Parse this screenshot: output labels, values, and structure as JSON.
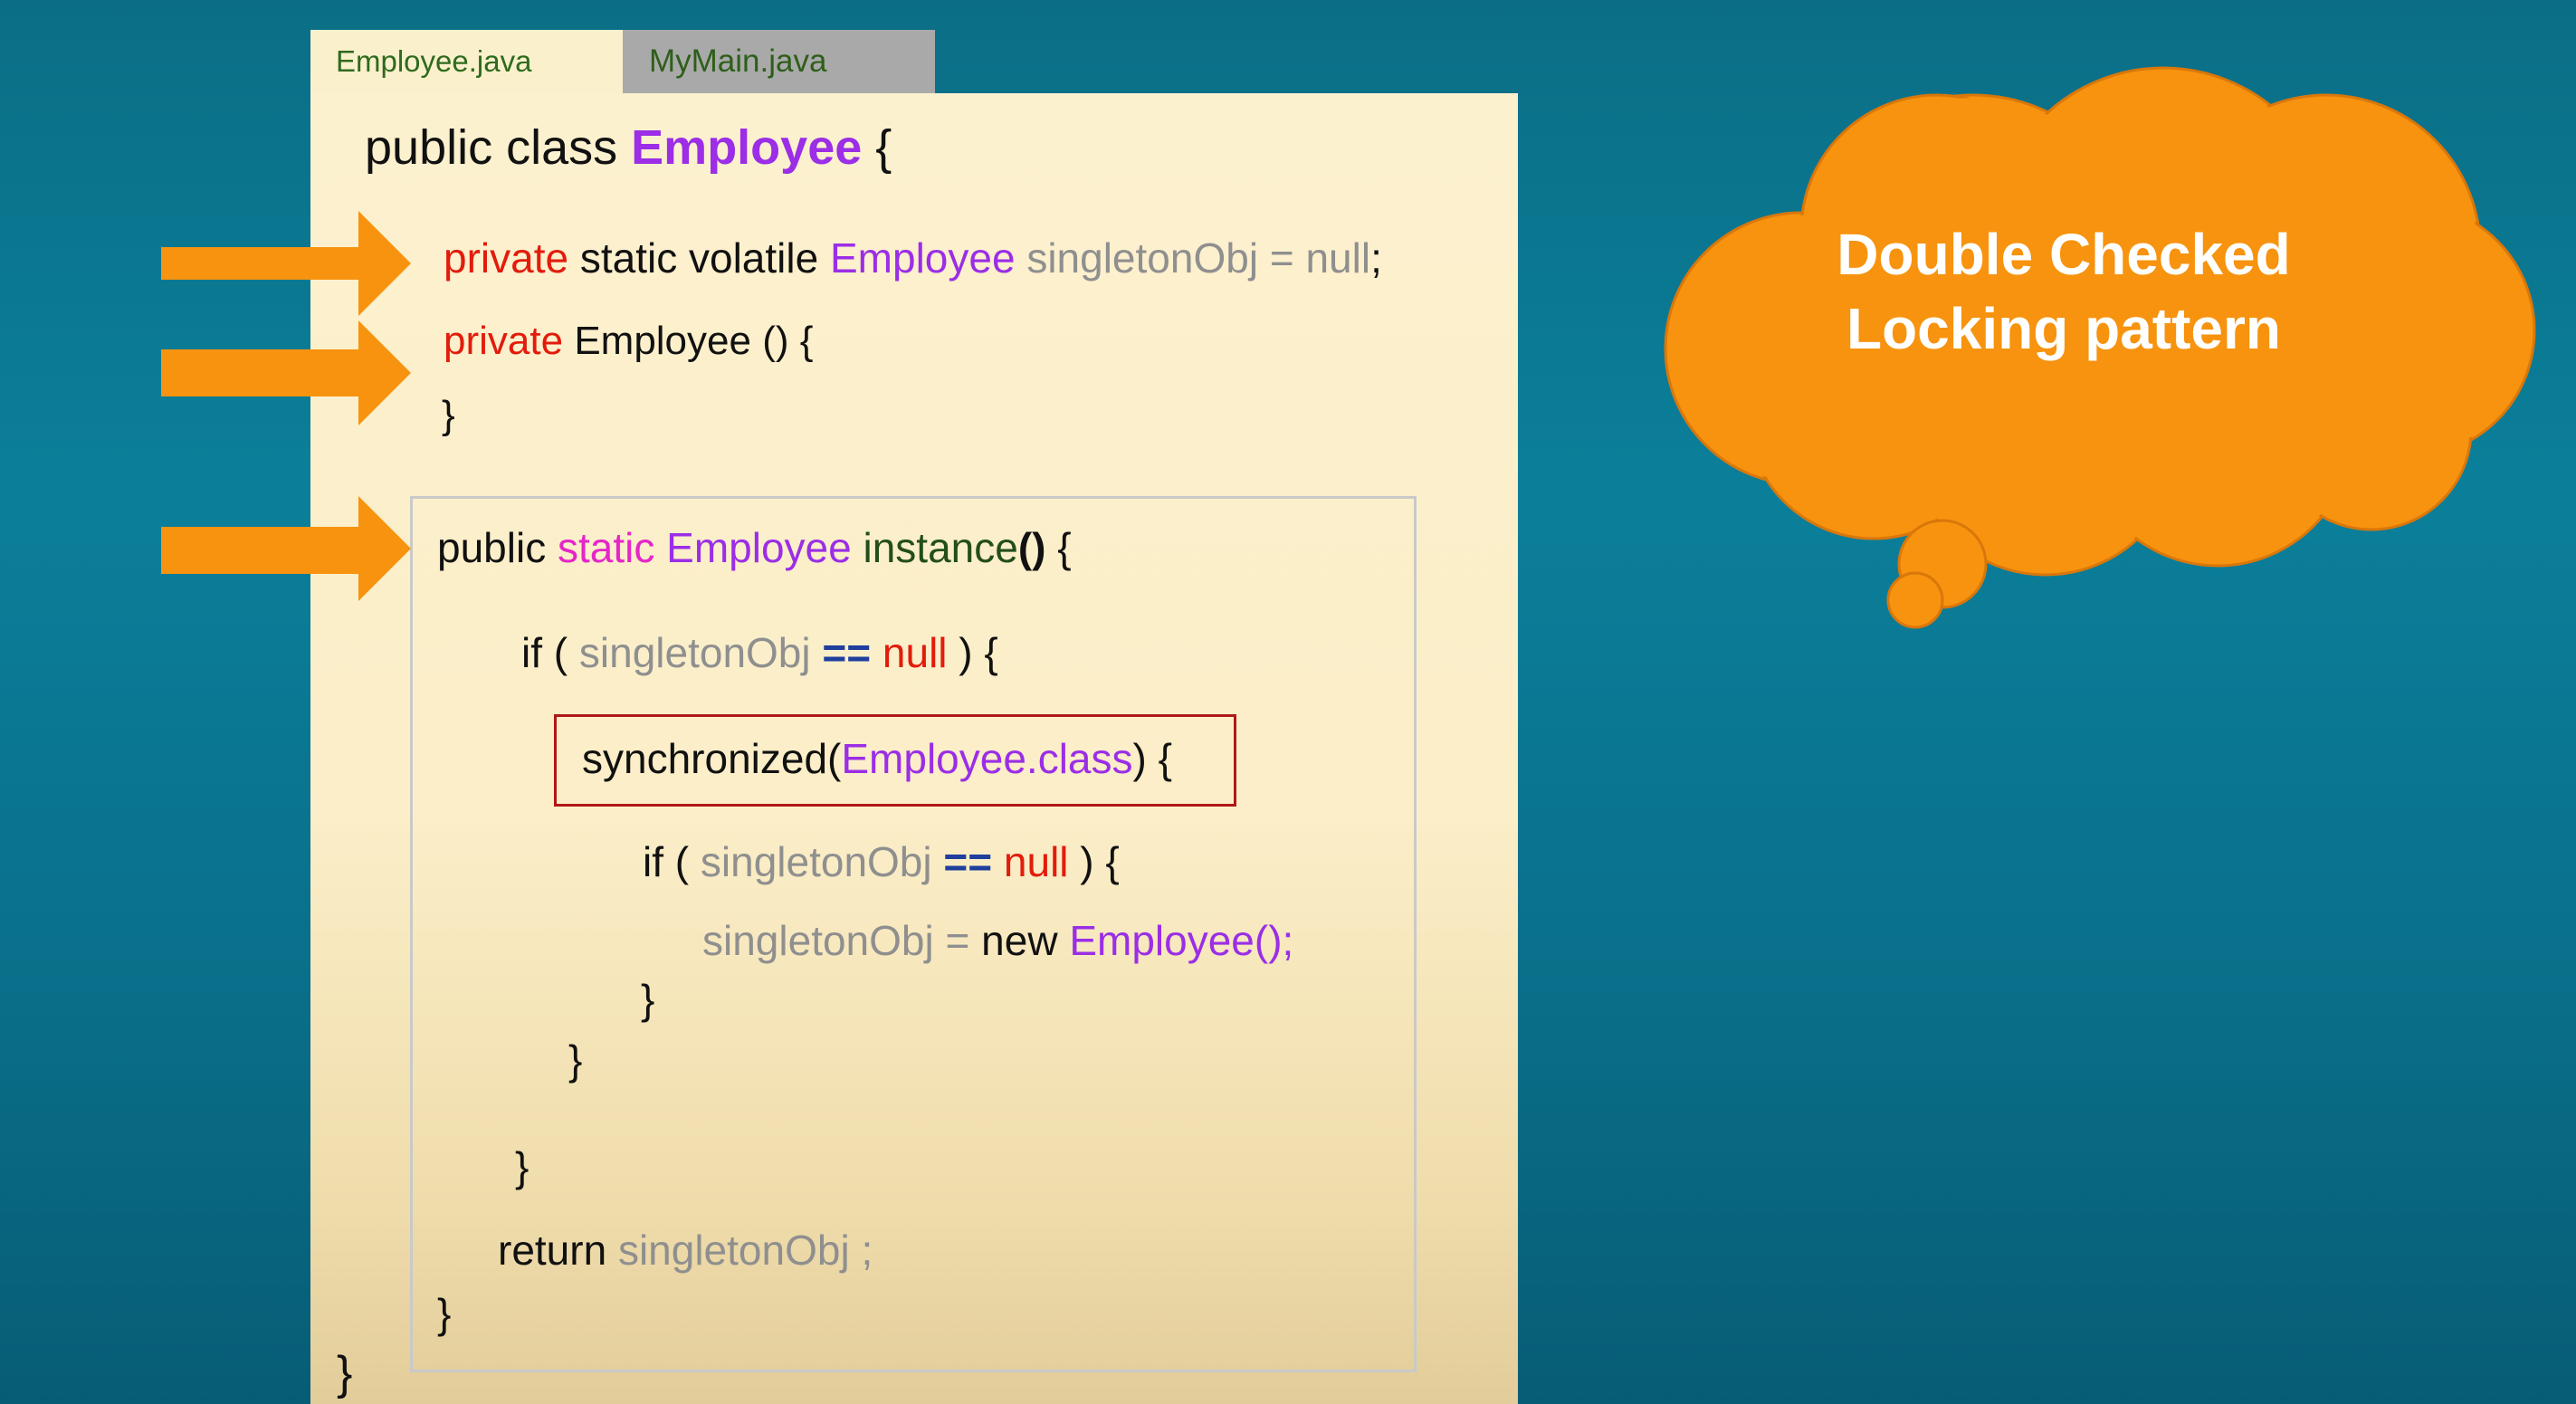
{
  "tabs": [
    {
      "label": "Employee.java",
      "active": true
    },
    {
      "label": "MyMain.java",
      "active": false
    }
  ],
  "code": {
    "class_decl": {
      "kw1": "public",
      "kw2": "class",
      "name": "Employee",
      "brace": "{"
    },
    "field": {
      "kw_private": "private",
      "kw_rest": "static volatile",
      "type": "Employee",
      "rest": "singletonObj = null",
      "semicolon": ";"
    },
    "constructor": {
      "kw_private": "private",
      "rest": "Employee () {"
    },
    "constructor_close": "}",
    "method_decl": {
      "kw_public": "public",
      "kw_static": "static",
      "type": "Employee",
      "name": "instance",
      "parens": "()",
      "brace": "{"
    },
    "if1": {
      "kw": "if",
      "open": "(",
      "var": "singletonObj",
      "op": "==",
      "null": "null",
      "close": ") {"
    },
    "sync": {
      "kw": "synchronized(",
      "arg": "Employee.class",
      "close": ") {"
    },
    "if2": {
      "kw": "if",
      "open": "(",
      "var": "singletonObj",
      "op": "==",
      "null": "null",
      "close": ") {"
    },
    "assign": {
      "var": "singletonObj =",
      "kw_new": "new",
      "ctor": "Employee();"
    },
    "close_if2": "}",
    "close_sync": "}",
    "close_if1": "}",
    "return_stmt": {
      "kw": "return",
      "var": "singletonObj ;"
    },
    "close_method": "}",
    "close_class": "}"
  },
  "callout": {
    "line1": "Double Checked",
    "line2": "Locking pattern"
  },
  "colors": {
    "background": "#0b7f9a",
    "editor": "#fbf0cc",
    "keyword_red": "#e21c0c",
    "type_purple": "#9b2ee6",
    "variable_gray": "#8f8f8f",
    "arrow_orange": "#f7930e",
    "cloud_orange": "#f7930e"
  },
  "icons": [
    "arrow-right-icon",
    "thought-cloud-icon"
  ]
}
